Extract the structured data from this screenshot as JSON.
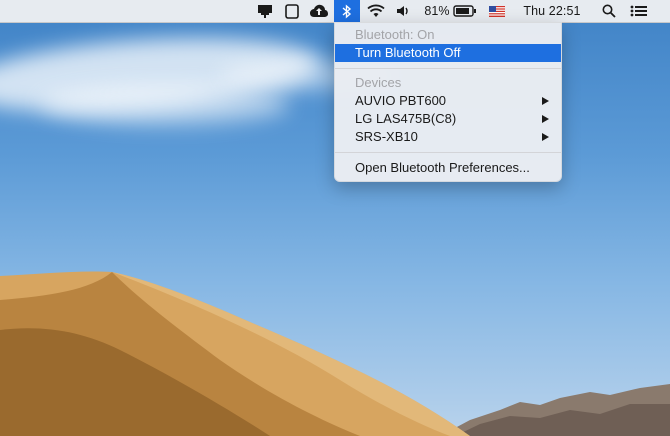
{
  "menubar": {
    "icons": [
      "presentation-icon",
      "tablet-icon",
      "cloud-upload-icon",
      "bluetooth-icon",
      "wifi-icon",
      "volume-icon",
      "battery-icon",
      "us-flag-icon",
      "search-icon",
      "list-icon"
    ],
    "battery_percent": "81%",
    "clock": "Thu 22:51",
    "accent_color": "#1e6fe0"
  },
  "bluetooth_menu": {
    "status": "Bluetooth: On",
    "toggle_label": "Turn Bluetooth Off",
    "devices_header": "Devices",
    "devices": [
      {
        "label": "AUVIO PBT600"
      },
      {
        "label": "LG LAS475B(C8)"
      },
      {
        "label": "SRS-XB10"
      }
    ],
    "preferences_label": "Open Bluetooth Preferences..."
  }
}
